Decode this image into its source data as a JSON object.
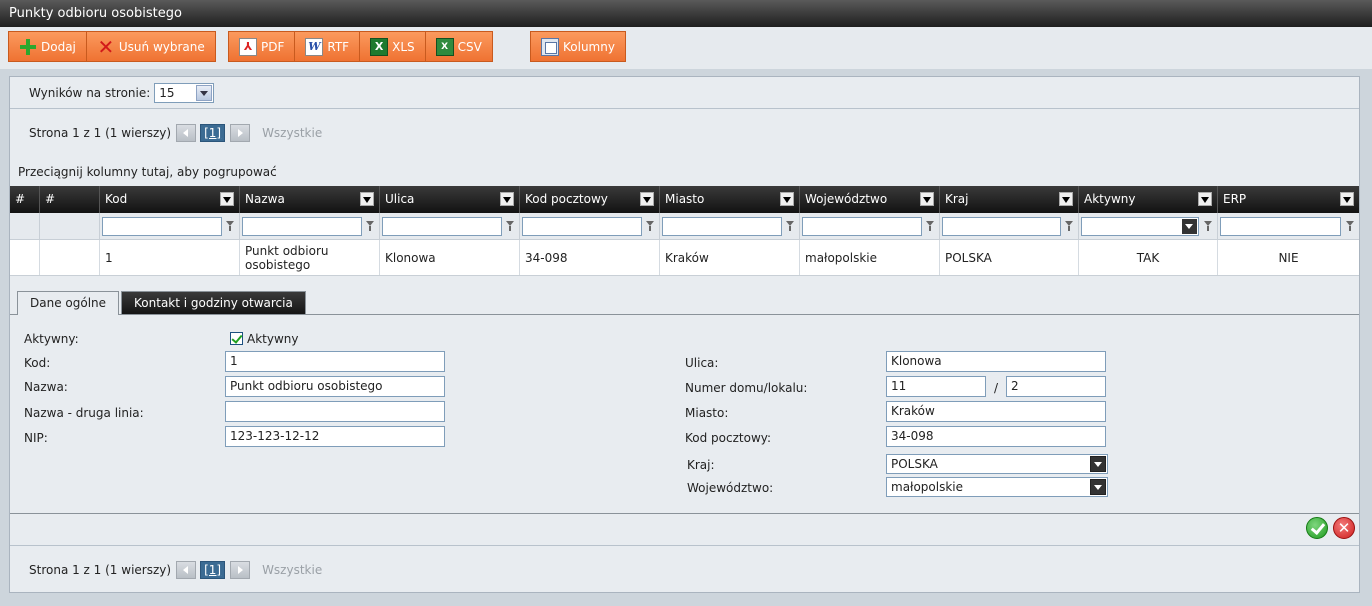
{
  "window": {
    "title": "Punkty odbioru osobistego"
  },
  "toolbar": {
    "add": "Dodaj",
    "delete_selected": "Usuń wybrane",
    "pdf": "PDF",
    "rtf": "RTF",
    "xls": "XLS",
    "csv": "CSV",
    "columns": "Kolumny",
    "icon_rtf": "W",
    "icon_xls": "X",
    "icon_csv": "X"
  },
  "results": {
    "label": "Wyników na stronie:",
    "value": "15"
  },
  "pager": {
    "info": "Strona 1 z 1 (1 wierszy)",
    "current": "[1]",
    "all": "Wszystkie"
  },
  "group_hint": "Przeciągnij kolumny tutaj, aby pogrupować",
  "grid": {
    "columns": [
      "#",
      "#",
      "Kod",
      "Nazwa",
      "Ulica",
      "Kod pocztowy",
      "Miasto",
      "Województwo",
      "Kraj",
      "Aktywny",
      "ERP"
    ],
    "row": {
      "kod": "1",
      "nazwa": "Punkt odbioru osobistego",
      "ulica": "Klonowa",
      "kod_pocztowy": "34-098",
      "miasto": "Kraków",
      "wojewodztwo": "małopolskie",
      "kraj": "POLSKA",
      "aktywny": "TAK",
      "erp": "NIE"
    }
  },
  "tabs": {
    "general": "Dane ogólne",
    "contact": "Kontakt i godziny otwarcia"
  },
  "form": {
    "aktywny_label": "Aktywny:",
    "aktywny_checkbox": "Aktywny",
    "kod_label": "Kod:",
    "kod": "1",
    "nazwa_label": "Nazwa:",
    "nazwa": "Punkt odbioru osobistego",
    "nazwa2_label": "Nazwa - druga linia:",
    "nazwa2": "",
    "nip_label": "NIP:",
    "nip": "123-123-12-12",
    "ulica_label": "Ulica:",
    "ulica": "Klonowa",
    "numer_label": "Numer domu/lokalu:",
    "numer_domu": "11",
    "numer_sep": "/",
    "numer_lokalu": "2",
    "miasto_label": "Miasto:",
    "miasto": "Kraków",
    "kod_pocztowy_label": "Kod pocztowy:",
    "kod_pocztowy": "34-098",
    "kraj_label": "Kraj:",
    "kraj": "POLSKA",
    "wojewodztwo_label": "Województwo:",
    "wojewodztwo": "małopolskie"
  },
  "actions": {
    "cancel_icon": "✕"
  }
}
